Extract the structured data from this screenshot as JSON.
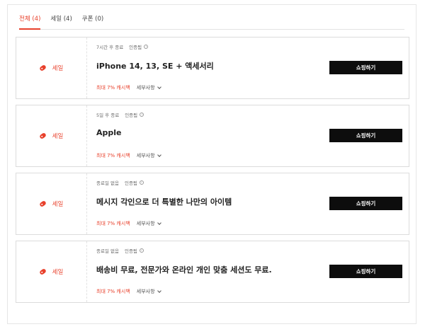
{
  "tabs": [
    {
      "label": "전체 (4)",
      "active": true
    },
    {
      "label": "세일 (4)",
      "active": false
    },
    {
      "label": "쿠폰 (0)",
      "active": false
    }
  ],
  "colors": {
    "accent": "#e8402b",
    "button": "#0d0d0d"
  },
  "icons": {
    "tag": "tag-icon",
    "info": "info-icon",
    "chevron": "chevron-down-icon"
  },
  "deals": [
    {
      "badge": "세일",
      "expiry": "7시간 후 종료",
      "verified": "인증됨",
      "title": "iPhone 14, 13, SE + 액세서리",
      "cashback": "최대 7% 캐시백",
      "details": "세부사항",
      "button": "쇼핑하기"
    },
    {
      "badge": "세일",
      "expiry": "5일 후 종료",
      "verified": "인증됨",
      "title": "Apple",
      "cashback": "최대 7% 캐시백",
      "details": "세부사항",
      "button": "쇼핑하기"
    },
    {
      "badge": "세일",
      "expiry": "종료일 없음",
      "verified": "인증됨",
      "title": "메시지 각인으로 더 특별한 나만의 아이템",
      "cashback": "최대 7% 캐시백",
      "details": "세부사항",
      "button": "쇼핑하기"
    },
    {
      "badge": "세일",
      "expiry": "종료일 없음",
      "verified": "인증됨",
      "title": "배송비 무료, 전문가와 온라인 개인 맞춤 세션도 무료.",
      "cashback": "최대 7% 캐시백",
      "details": "세부사항",
      "button": "쇼핑하기"
    }
  ]
}
